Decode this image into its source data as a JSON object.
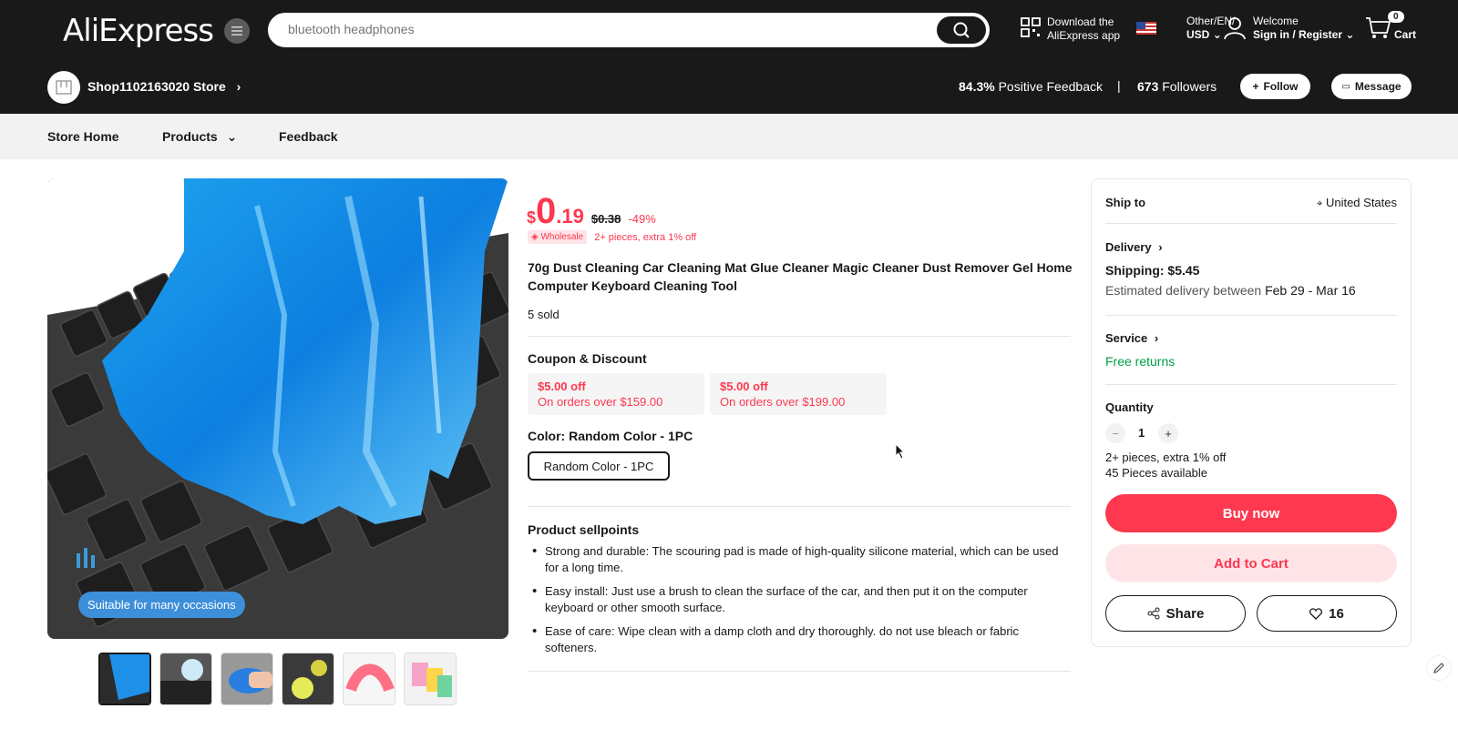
{
  "header": {
    "logo": "AliExpress",
    "search_placeholder": "bluetooth headphones",
    "app_line1": "Download the",
    "app_line2": "AliExpress app",
    "locale_line1": "Other/EN/",
    "locale_line2": "USD",
    "account_line1": "Welcome",
    "account_line2": "Sign in / Register",
    "cart_count": "0",
    "cart_label": "Cart"
  },
  "store": {
    "name": "Shop1102163020 Store",
    "feedback_pct": "84.3%",
    "feedback_label": "Positive Feedback",
    "separator": "|",
    "followers_count": "673",
    "followers_label": "Followers",
    "follow_label": "Follow",
    "message_label": "Message"
  },
  "nav": {
    "items": [
      "Store Home",
      "Products",
      "Feedback"
    ]
  },
  "gallery": {
    "image_tag": "Suitable for many occasions"
  },
  "product": {
    "currency": "$",
    "price_int": "0",
    "price_dec": ".19",
    "original_price": "$0.38",
    "discount": "-49%",
    "wholesale_badge": "Wholesale",
    "wholesale_text": "2+ pieces, extra 1% off",
    "title": "70g Dust Cleaning Car Cleaning Mat Glue Cleaner Magic Cleaner Dust Remover Gel Home Computer Keyboard Cleaning Tool",
    "sold": "5 sold",
    "coupon_title": "Coupon & Discount",
    "coupons": [
      {
        "amount": "$5.00 off",
        "condition": "On orders over $159.00"
      },
      {
        "amount": "$5.00 off",
        "condition": "On orders over $199.00"
      }
    ],
    "color_label": "Color: Random Color - 1PC",
    "color_option": "Random Color - 1PC",
    "sellpoints_title": "Product sellpoints",
    "sellpoints": [
      "Strong and durable: The scouring pad is made of high-quality silicone material, which can be used for a long time.",
      "Easy install: Just use a brush to clean the surface of the car, and then put it on the computer keyboard or other smooth surface.",
      "Ease of care: Wipe clean with a damp cloth and dry thoroughly. do not use bleach or fabric softeners."
    ]
  },
  "panel": {
    "ship_to_label": "Ship to",
    "ship_to_value": "United States",
    "delivery_label": "Delivery",
    "shipping": "Shipping: $5.45",
    "est_prefix": "Estimated delivery between",
    "est_dates": "Feb 29 - Mar 16",
    "service_label": "Service",
    "free_returns": "Free returns",
    "quantity_label": "Quantity",
    "quantity_value": "1",
    "qty_note": "2+ pieces, extra 1% off",
    "available": "45 Pieces available",
    "buy_now": "Buy now",
    "add_to_cart": "Add to Cart",
    "share": "Share",
    "wishlist_count": "16"
  },
  "colors": {
    "accent": "#fd384f",
    "header_bg": "#191919",
    "success": "#00a046"
  }
}
